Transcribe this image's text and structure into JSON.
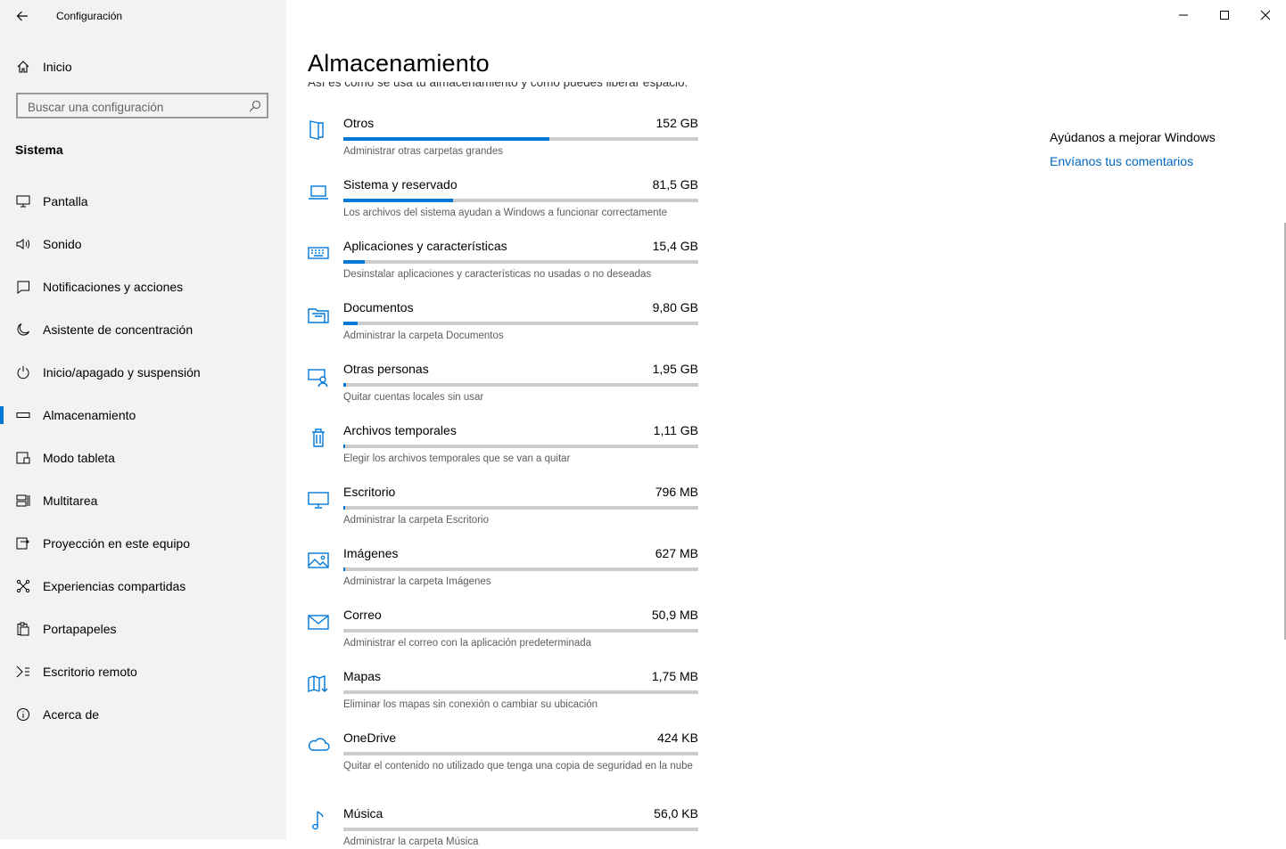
{
  "window": {
    "title": "Configuración"
  },
  "sidebar": {
    "home_label": "Inicio",
    "search_placeholder": "Buscar una configuración",
    "section_title": "Sistema",
    "items": [
      {
        "label": "Pantalla",
        "icon": "monitor-icon"
      },
      {
        "label": "Sonido",
        "icon": "speaker-icon"
      },
      {
        "label": "Notificaciones y acciones",
        "icon": "message-icon"
      },
      {
        "label": "Asistente de concentración",
        "icon": "moon-icon"
      },
      {
        "label": "Inicio/apagado y suspensión",
        "icon": "power-icon"
      },
      {
        "label": "Almacenamiento",
        "icon": "drive-icon",
        "active": true
      },
      {
        "label": "Modo tableta",
        "icon": "tablet-icon"
      },
      {
        "label": "Multitarea",
        "icon": "multitask-icon"
      },
      {
        "label": "Proyección en este equipo",
        "icon": "projection-icon"
      },
      {
        "label": "Experiencias compartidas",
        "icon": "share-icon"
      },
      {
        "label": "Portapapeles",
        "icon": "clipboard-icon"
      },
      {
        "label": "Escritorio remoto",
        "icon": "remote-icon"
      },
      {
        "label": "Acerca de",
        "icon": "info-icon"
      }
    ]
  },
  "main": {
    "title": "Almacenamiento",
    "subtitle": "Así es como se usa tu almacenamiento y cómo puedes liberar espacio.",
    "categories": [
      {
        "name": "Otros",
        "size": "152 GB",
        "desc": "Administrar otras carpetas grandes",
        "usage": 0.58,
        "icon": "folder-icon"
      },
      {
        "name": "Sistema y reservado",
        "size": "81,5 GB",
        "desc": "Los archivos del sistema ayudan a Windows a funcionar correctamente",
        "usage": 0.31,
        "icon": "laptop-icon"
      },
      {
        "name": "Aplicaciones y características",
        "size": "15,4 GB",
        "desc": "Desinstalar aplicaciones y características no usadas o no deseadas",
        "usage": 0.06,
        "icon": "keyboard-icon"
      },
      {
        "name": "Documentos",
        "size": "9,80 GB",
        "desc": "Administrar la carpeta Documentos",
        "usage": 0.04,
        "icon": "documents-folder-icon"
      },
      {
        "name": "Otras personas",
        "size": "1,95 GB",
        "desc": "Quitar cuentas locales sin usar",
        "usage": 0.008,
        "icon": "people-icon"
      },
      {
        "name": "Archivos temporales",
        "size": "1,11 GB",
        "desc": "Elegir los archivos temporales que se van a quitar",
        "usage": 0.005,
        "icon": "trash-icon"
      },
      {
        "name": "Escritorio",
        "size": "796 MB",
        "desc": "Administrar la carpeta Escritorio",
        "usage": 0.004,
        "icon": "desktop-icon"
      },
      {
        "name": "Imágenes",
        "size": "627 MB",
        "desc": "Administrar la carpeta Imágenes",
        "usage": 0.004,
        "icon": "picture-icon"
      },
      {
        "name": "Correo",
        "size": "50,9 MB",
        "desc": "Administrar el correo con la aplicación predeterminada",
        "usage": 0.0,
        "icon": "mail-icon"
      },
      {
        "name": "Mapas",
        "size": "1,75 MB",
        "desc": "Eliminar los mapas sin conexión o cambiar su ubicación",
        "usage": 0.0,
        "icon": "map-icon"
      },
      {
        "name": "OneDrive",
        "size": "424 KB",
        "desc": "Quitar el contenido no utilizado que tenga una copia de seguridad en la nube",
        "usage": 0.0,
        "icon": "cloud-icon"
      },
      {
        "name": "Música",
        "size": "56,0 KB",
        "desc": "Administrar la carpeta Música",
        "usage": 0.0,
        "icon": "music-icon"
      }
    ]
  },
  "help": {
    "title": "Ayúdanos a mejorar Windows",
    "link": "Envíanos tus comentarios"
  },
  "colors": {
    "accent": "#0078d7",
    "sidebar_bg": "#f2f2f2",
    "link": "#0067c0"
  }
}
